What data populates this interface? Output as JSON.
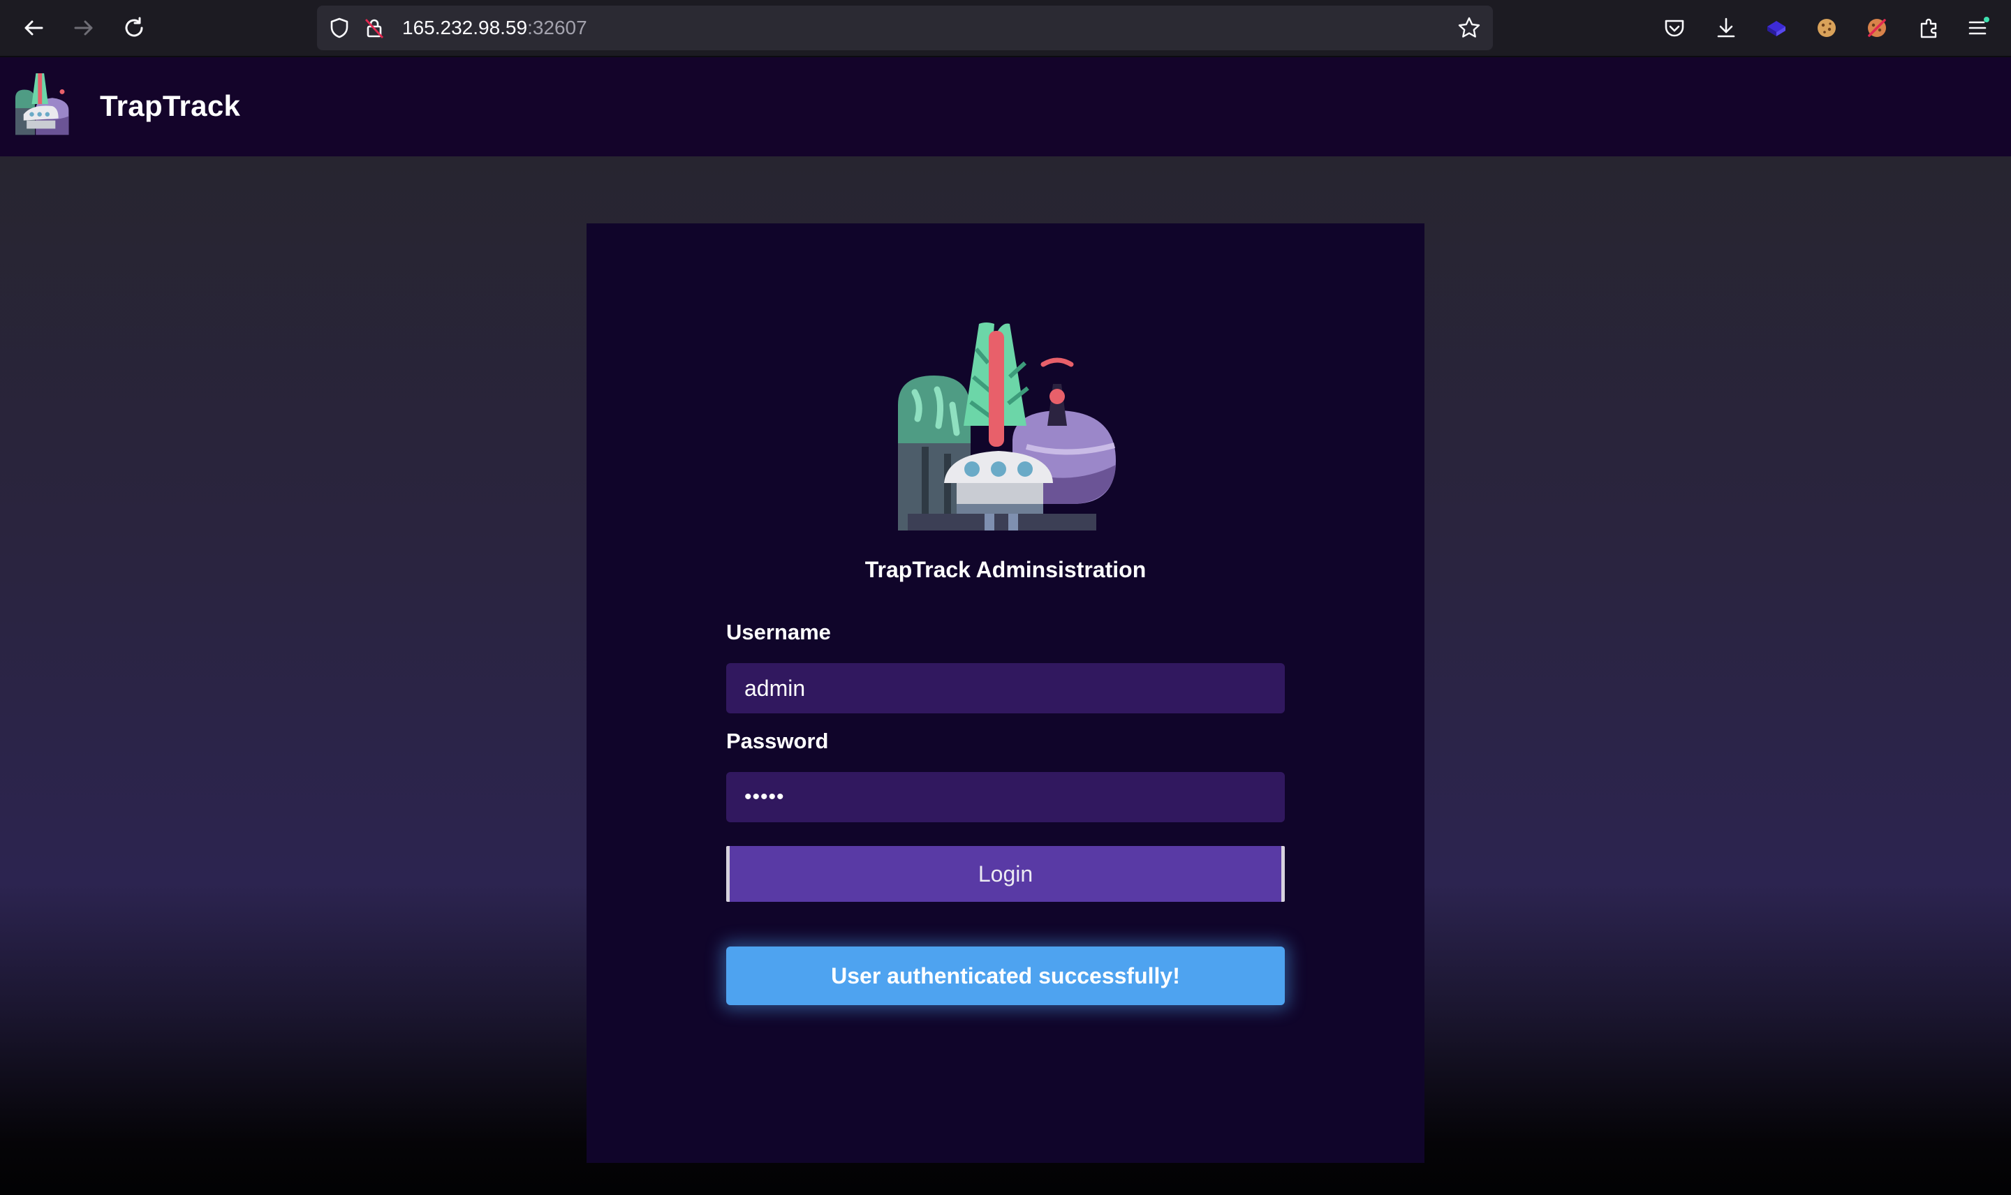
{
  "browser": {
    "url_host": "165.232.98.59",
    "url_port": ":32607",
    "back_icon": "arrow-left-icon",
    "forward_icon": "arrow-right-icon",
    "reload_icon": "reload-icon"
  },
  "app": {
    "brand": "TrapTrack"
  },
  "login": {
    "title": "TrapTrack Adminsistration",
    "username_label": "Username",
    "username_value": "admin",
    "password_label": "Password",
    "password_value": "•••••",
    "login_button": "Login",
    "alert_message": "User authenticated successfully!"
  },
  "colors": {
    "appbar_bg": "#14042a",
    "card_bg": "#10052a",
    "field_bg": "#31185f",
    "button_bg": "#593aa5",
    "alert_bg": "#4ea3f0"
  }
}
